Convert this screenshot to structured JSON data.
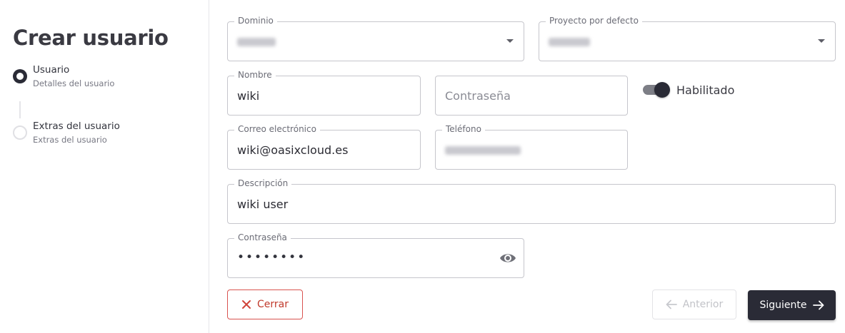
{
  "sidebar": {
    "title": "Crear usuario",
    "steps": [
      {
        "title": "Usuario",
        "subtitle": "Detalles del usuario",
        "active": true
      },
      {
        "title": "Extras del usuario",
        "subtitle": "Extras del usuario",
        "active": false
      }
    ]
  },
  "form": {
    "domain": {
      "label": "Dominio",
      "value": ""
    },
    "default_project": {
      "label": "Proyecto por defecto",
      "value": ""
    },
    "name": {
      "label": "Nombre",
      "value": "wiki"
    },
    "password_confirm": {
      "placeholder": "Contraseña"
    },
    "enabled": {
      "label": "Habilitado",
      "on": true
    },
    "email": {
      "label": "Correo electrónico",
      "value": "wiki@oasixcloud.es"
    },
    "phone": {
      "label": "Teléfono",
      "value": ""
    },
    "description": {
      "label": "Descripción",
      "value": "wiki user"
    },
    "password": {
      "label": "Contraseña",
      "value": "••••••••"
    }
  },
  "actions": {
    "close_label": "Cerrar",
    "prev_label": "Anterior",
    "next_label": "Siguiente"
  },
  "icons": {
    "close": "close-icon",
    "prev": "arrow-left-icon",
    "next": "arrow-right-icon",
    "eye": "eye-icon",
    "dropdown": "chevron-down-icon"
  },
  "colors": {
    "primary": "#2a2b36",
    "danger": "#c0392b",
    "border": "#c6c6cc"
  }
}
